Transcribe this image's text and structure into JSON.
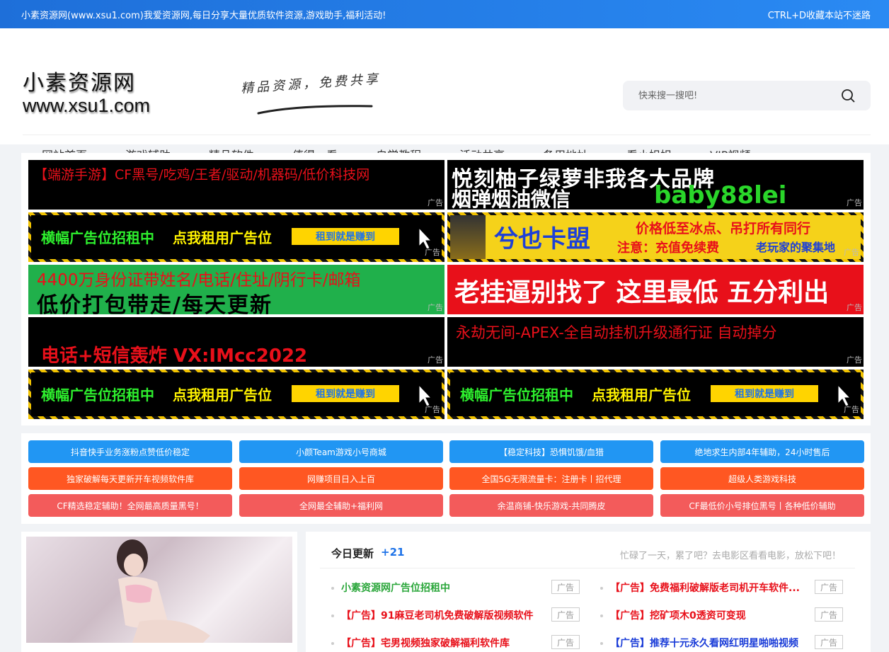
{
  "topbar": {
    "left": "小素资源网(www.xsu1.com)我爱资源网,每日分享大量优质软件资源,游戏助手,福利活动!",
    "right": "CTRL+D收藏本站不迷路"
  },
  "logo": {
    "line1": "小素资源网",
    "line2": "www.xsu1.com"
  },
  "slogan": "精品资源，免费共享",
  "search": {
    "placeholder": "快来搜一搜吧!"
  },
  "nav": [
    "网站首页",
    "游戏辅助",
    "精品软件",
    "值得一看",
    "自学教程",
    "活动共享",
    "备用地址",
    "看小姐姐",
    "VIP视频"
  ],
  "ad_tag": "广告",
  "ads": {
    "a1": "【端游手游】CF黑号/吃鸡/王者/驱动/机器码/低价科技网",
    "a2_l1": "悦刻柚子绿萝非我各大品牌",
    "a2_l2a": "烟弹烟油微信",
    "a2_l2b": "baby88lei",
    "rent_a": "横幅广告位招租中",
    "rent_b": "点我租用广告位",
    "rent_c": "租到就是赚到",
    "a4_logo": "兮也卡盟",
    "a4_l1": "价格低至冰点、吊打所有同行",
    "a4_l2a": "注意：充值免续费",
    "a4_l2b": "老玩家的聚集地",
    "a5_l1": "4400万身份证带姓名/电话/住址/阴行卡/邮箱",
    "a5_l2": "低价打包带走/每天更新",
    "a6": "老挂逼别找了 这里最低 五分利出",
    "a7": "电话+短信轰炸 VX:IMcc2022",
    "a8": "永劫无间-APEX-全自动挂机升级通行证 自动掉分"
  },
  "links": [
    [
      "抖音快手业务涨粉点赞低价稳定",
      "小颜Team游戏小号商城",
      "【稳定科技】恐惧饥饿/血猎",
      "绝地求生内部4年辅助，24小时售后"
    ],
    [
      "独家破解每天更新开车视频软件库",
      "网赚项目日入上百",
      "全国5G无限流量卡：注册卡丨招代理",
      "超级人类游戏科技"
    ],
    [
      "CF精选稳定辅助！全网最高质量黑号！",
      "全网最全辅助+福利网",
      "余温商铺-快乐游戏-共同腾皮",
      "CF最低价小号排位黑号丨各种低价辅助"
    ]
  ],
  "link_colors": [
    "#2196f3",
    "#ff5722",
    "#f35b5b"
  ],
  "updates": {
    "title": "今日更新",
    "count": "+21",
    "hint": "忙碌了一天，累了吧？去电影区看看电影，放松下吧！",
    "badge": "广告",
    "rows": [
      {
        "text": "小素资源网广告位招租中",
        "color": "#2aa63a"
      },
      {
        "text": "【广告】免费福利破解版老司机开车软件...",
        "color": "#e8101a"
      },
      {
        "text": "【广告】91麻豆老司机免费破解版视频软件",
        "color": "#e8101a"
      },
      {
        "text": "【广告】挖矿项木0透资可变现",
        "color": "#e8101a"
      },
      {
        "text": "【广告】宅男视频独家破解福利软件库",
        "color": "#e8101a"
      },
      {
        "text": "【广告】推荐十元永久看网红明星啪啪视频",
        "color": "#1a3cd8"
      }
    ]
  }
}
